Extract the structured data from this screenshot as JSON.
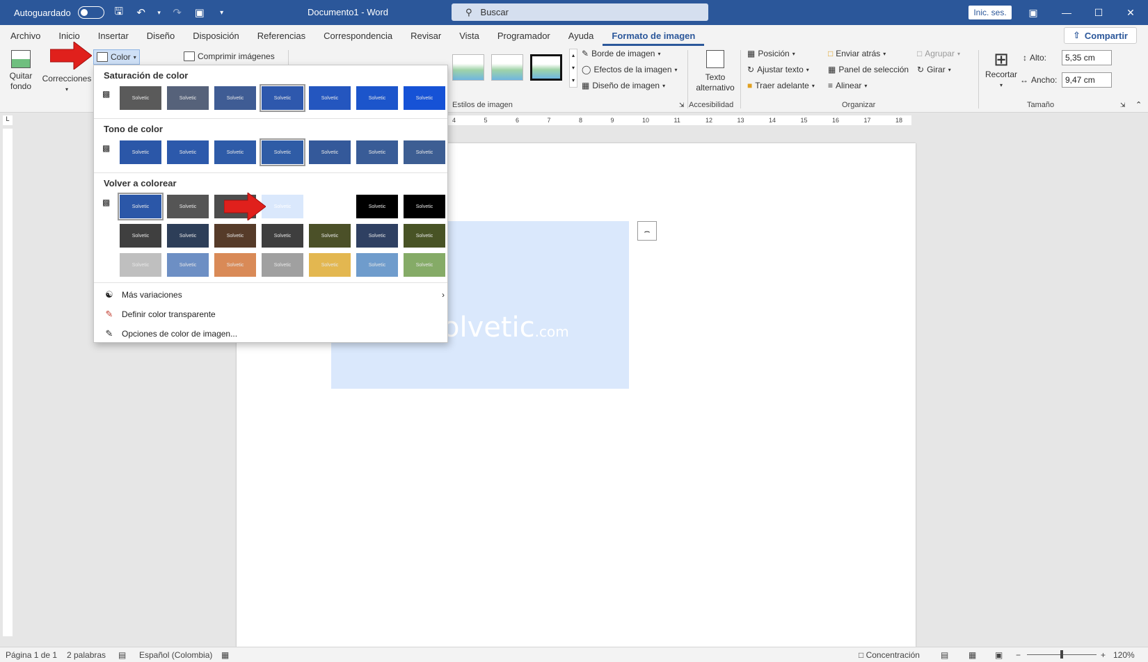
{
  "titlebar": {
    "autosave_label": "Autoguardado",
    "doc_title": "Documento1  -  Word",
    "search_placeholder": "Buscar",
    "signin_label": "Inic. ses."
  },
  "tabs": [
    "Archivo",
    "Inicio",
    "Insertar",
    "Diseño",
    "Disposición",
    "Referencias",
    "Correspondencia",
    "Revisar",
    "Vista",
    "Programador",
    "Ayuda",
    "Formato de imagen"
  ],
  "share_label": "Compartir",
  "ribbon": {
    "quitar_fondo": [
      "Quitar",
      "fondo"
    ],
    "correcciones": "Correcciones",
    "color": "Color",
    "comprimir": "Comprimir imágenes",
    "borde": "Borde de imagen",
    "efectos": "Efectos de la imagen",
    "diseno": "Diseño de imagen",
    "estilos_label": "Estilos de imagen",
    "texto_alt": [
      "Texto",
      "alternativo"
    ],
    "accesibilidad_label": "Accesibilidad",
    "posicion": "Posición",
    "ajustar": "Ajustar texto",
    "traer": "Traer adelante",
    "enviar": "Enviar atrás",
    "panel": "Panel de selección",
    "alinear": "Alinear",
    "agrupar": "Agrupar",
    "girar": "Girar",
    "organizar_label": "Organizar",
    "recortar": "Recortar",
    "alto_label": "Alto:",
    "alto_value": "5,35 cm",
    "ancho_label": "Ancho:",
    "ancho_value": "9,47 cm",
    "tamano_label": "Tamaño"
  },
  "ruler_numbers": [
    "4",
    "5",
    "6",
    "7",
    "8",
    "9",
    "10",
    "11",
    "12",
    "13",
    "14",
    "15",
    "16",
    "17",
    "18"
  ],
  "dropdown": {
    "saturacion": "Saturación de color",
    "tono": "Tono de color",
    "volver": "Volver a colorear",
    "mas": "Más variaciones",
    "definir": "Definir color transparente",
    "opciones": "Opciones de color de imagen...",
    "saturacion_colors": [
      "#5a5a5a",
      "#56627a",
      "#3f5c94",
      "#2e58ad",
      "#2456bf",
      "#1c55cb",
      "#1652d6"
    ],
    "tono_colors": [
      "#2b57a8",
      "#2c59ab",
      "#2e5ba8",
      "#2f5ca6",
      "#34599a",
      "#395c97",
      "#3d5e93"
    ],
    "volver_row1": [
      "#2b57a8",
      "#555555",
      "#4d4d4d",
      "#dae8fc",
      "#ffffff",
      "#000000",
      "#000000"
    ],
    "volver_row2": [
      "#3f3f3f",
      "#2d3e58",
      "#563b29",
      "#3e3e3e",
      "#4b5028",
      "#2f4062",
      "#485325"
    ],
    "volver_row3": [
      "#bfbfbf",
      "#6d8fc4",
      "#d98a57",
      "#a0a0a0",
      "#e3b750",
      "#6f9ccc",
      "#85ab67"
    ],
    "swatch_text": "Solvetic"
  },
  "picture": {
    "logo_text": "olvetic",
    "logo_suffix": ".com"
  },
  "status": {
    "page": "Página 1 de 1",
    "words": "2 palabras",
    "language": "Español (Colombia)",
    "focus": "Concentración",
    "zoom": "120%"
  }
}
